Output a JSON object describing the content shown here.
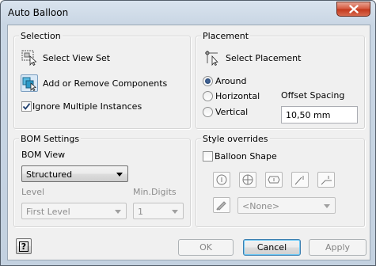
{
  "window": {
    "title": "Auto Balloon"
  },
  "selection": {
    "group_label": "Selection",
    "select_view_set": "Select View Set",
    "add_remove_components": "Add or Remove Components",
    "ignore_multiple_instances": "Ignore Multiple Instances",
    "ignore_multiple_instances_checked": true
  },
  "placement": {
    "group_label": "Placement",
    "select_placement": "Select Placement",
    "options": [
      "Around",
      "Horizontal",
      "Vertical"
    ],
    "selected_option": "Around",
    "offset_spacing_label": "Offset Spacing",
    "offset_spacing_value": "10,50 mm"
  },
  "bom_settings": {
    "group_label": "BOM Settings",
    "bom_view_label": "BOM View",
    "bom_view_value": "Structured",
    "level_label": "Level",
    "level_value": "First Level",
    "min_digits_label": "Min.Digits",
    "min_digits_value": "1"
  },
  "style_overrides": {
    "group_label": "Style overrides",
    "balloon_shape_label": "Balloon Shape",
    "balloon_shape_checked": false,
    "shape_value": "<None>"
  },
  "footer": {
    "help_icon": "?",
    "ok_label": "OK",
    "cancel_label": "Cancel",
    "apply_label": "Apply"
  }
}
